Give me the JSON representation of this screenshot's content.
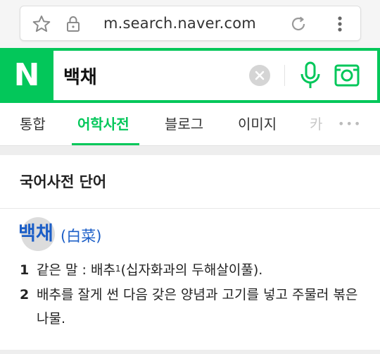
{
  "browser": {
    "url": "m.search.naver.com"
  },
  "search": {
    "logo_text": "N",
    "query": "백채",
    "brand_color": "#03c75a"
  },
  "tabs": [
    {
      "label": "통합",
      "active": false
    },
    {
      "label": "어학사전",
      "active": true
    },
    {
      "label": "블로그",
      "active": false
    },
    {
      "label": "이미지",
      "active": false
    },
    {
      "label": "카",
      "active": false
    }
  ],
  "more_tabs": "•••",
  "dictionary": {
    "section_title": "국어사전 단어",
    "word": "백채",
    "hanja": "(白菜)",
    "definitions": [
      {
        "num": "1",
        "text_before": "같은 말 : 배추",
        "sup": "1",
        "text_after": "(십자화과의 두해살이풀)."
      },
      {
        "num": "2",
        "text": "배추를 잘게 썬 다음 갖은 양념과 고기를 넣고 주물러 볶은 나물."
      }
    ]
  }
}
